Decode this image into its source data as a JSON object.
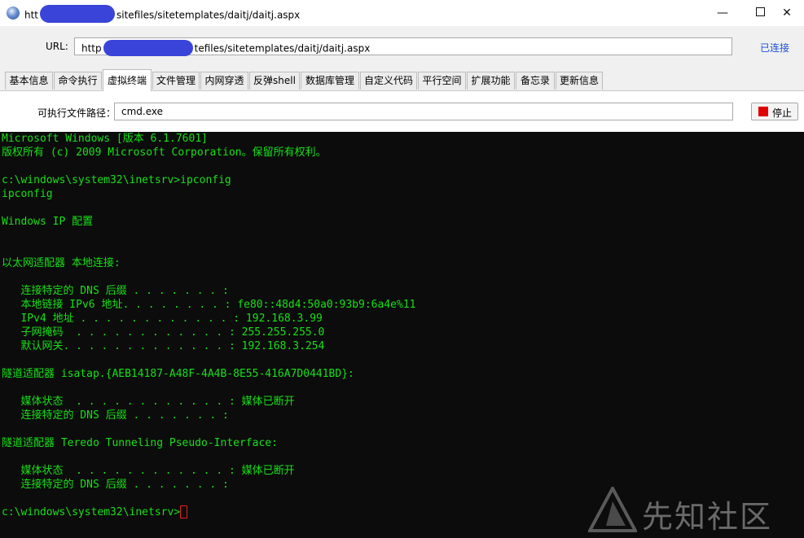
{
  "window": {
    "title_prefix": "htt",
    "title_suffix": "sitefiles/sitetemplates/daitj/daitj.aspx",
    "minimize": "—",
    "close": "✕"
  },
  "url_bar": {
    "label": "URL:",
    "value_prefix": "http",
    "value_suffix": "tefiles/sitetemplates/daitj/daitj.aspx",
    "status": "已连接"
  },
  "tabs": [
    {
      "label": "基本信息"
    },
    {
      "label": "命令执行"
    },
    {
      "label": "虚拟终端"
    },
    {
      "label": "文件管理"
    },
    {
      "label": "内网穿透"
    },
    {
      "label": "反弹shell"
    },
    {
      "label": "数据库管理"
    },
    {
      "label": "自定义代码"
    },
    {
      "label": "平行空间"
    },
    {
      "label": "扩展功能"
    },
    {
      "label": "备忘录"
    },
    {
      "label": "更新信息"
    }
  ],
  "active_tab": "虚拟终端",
  "executable": {
    "label": "可执行文件路径：",
    "value": "cmd.exe",
    "stop_label": "停止"
  },
  "terminal": {
    "text_color": "#16e016",
    "lines": [
      "Microsoft Windows [版本 6.1.7601]",
      "版权所有 (c) 2009 Microsoft Corporation。保留所有权利。",
      "",
      "c:\\windows\\system32\\inetsrv>ipconfig",
      "ipconfig",
      "",
      "Windows IP 配置",
      "",
      "",
      "以太网适配器 本地连接:",
      "",
      "   连接特定的 DNS 后缀 . . . . . . . :",
      "   本地链接 IPv6 地址. . . . . . . . : fe80::48d4:50a0:93b9:6a4e%11",
      "   IPv4 地址 . . . . . . . . . . . . : 192.168.3.99",
      "   子网掩码  . . . . . . . . . . . . : 255.255.255.0",
      "   默认网关. . . . . . . . . . . . . : 192.168.3.254",
      "",
      "隧道适配器 isatap.{AEB14187-A48F-4A4B-8E55-416A7D0441BD}:",
      "",
      "   媒体状态  . . . . . . . . . . . . : 媒体已断开",
      "   连接特定的 DNS 后缀 . . . . . . . :",
      "",
      "隧道适配器 Teredo Tunneling Pseudo-Interface:",
      "",
      "   媒体状态  . . . . . . . . . . . . : 媒体已断开",
      "   连接特定的 DNS 后缀 . . . . . . . :",
      "",
      "c:\\windows\\system32\\inetsrv>"
    ]
  },
  "watermark": {
    "text": "先知社区",
    "icon": "xianzhi-logo-icon"
  }
}
